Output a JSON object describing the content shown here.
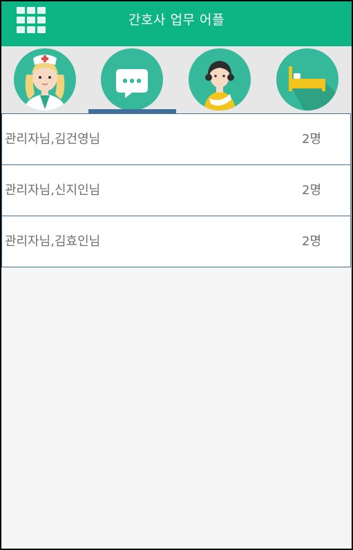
{
  "app_bar": {
    "title": "간호사 업무 어플",
    "menu_icon": "grid-menu-icon",
    "color": "#0db484"
  },
  "tabs": [
    {
      "icon": "nurse-icon",
      "bg": "#36b89a",
      "selected": false
    },
    {
      "icon": "chat-icon",
      "bg": "#36b89a",
      "selected": true
    },
    {
      "icon": "patient-icon",
      "bg": "#36b89a",
      "selected": false
    },
    {
      "icon": "bed-icon",
      "bg": "#36b89a",
      "selected": false
    }
  ],
  "list": [
    {
      "name": "관리자님,김건영님",
      "count": "2명"
    },
    {
      "name": "관리자님,신지인님",
      "count": "2명"
    },
    {
      "name": "관리자님,김효인님",
      "count": "2명"
    }
  ],
  "colors": {
    "accent": "#0db484",
    "indicator": "#3f6f9a",
    "item_text": "#6e6e6e",
    "background": "#f5f5f5"
  }
}
